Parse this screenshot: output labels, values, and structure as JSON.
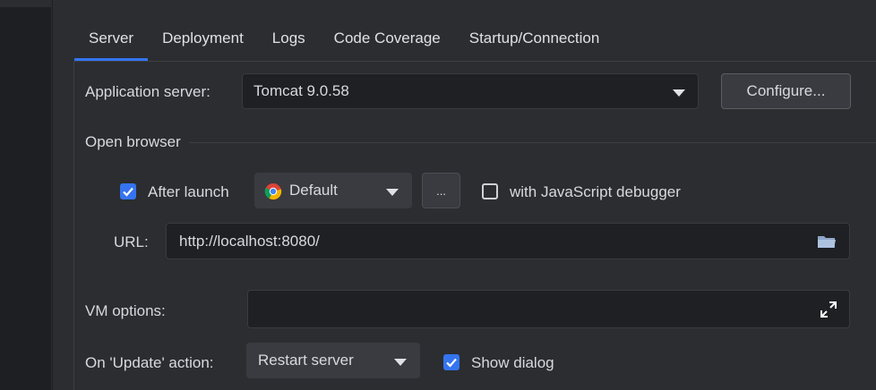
{
  "tabs": [
    "Server",
    "Deployment",
    "Logs",
    "Code Coverage",
    "Startup/Connection"
  ],
  "active_tab": "Server",
  "app_server": {
    "label": "Application server:",
    "value": "Tomcat 9.0.58",
    "configure_label": "Configure..."
  },
  "open_browser": {
    "section_label": "Open browser",
    "after_launch_label": "After launch",
    "after_launch_checked": true,
    "browser_value": "Default",
    "browser_icon": "chrome-icon",
    "ellipsis_label": "...",
    "js_debugger_label": "with JavaScript debugger",
    "js_debugger_checked": false,
    "url_label": "URL:",
    "url_value": "http://localhost:8080/"
  },
  "vm_options": {
    "label": "VM options:",
    "value": ""
  },
  "update_action": {
    "label": "On 'Update' action:",
    "value": "Restart server",
    "show_dialog_label": "Show dialog",
    "show_dialog_checked": true
  },
  "colors": {
    "accent": "#3574f0",
    "background": "#2b2d30",
    "field_bg": "#1f2023"
  }
}
